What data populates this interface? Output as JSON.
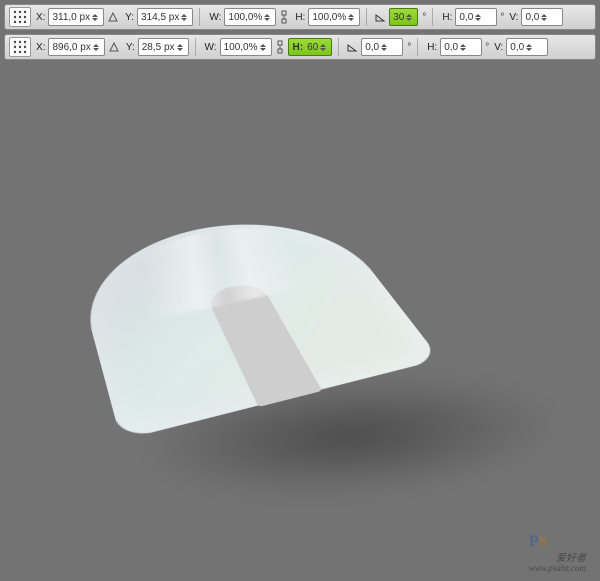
{
  "toolbar1": {
    "x_label": "X:",
    "x_value": "311,0 px",
    "y_label": "Y:",
    "y_value": "314,5 px",
    "w_label": "W:",
    "w_value": "100,0%",
    "h_label": "H:",
    "h_value": "100,0%",
    "angle_value": "30",
    "hshear_label": "H:",
    "hshear_value": "0,0",
    "vshear_label": "V:",
    "vshear_value": "0,0"
  },
  "toolbar2": {
    "x_label": "X:",
    "x_value": "896,0 px",
    "y_label": "Y:",
    "y_value": "28,5 px",
    "w_label": "W:",
    "w_value": "100,0%",
    "h_label": "H:",
    "h_value": "60",
    "angle_value": "0,0",
    "hshear_label": "H:",
    "hshear_value": "0,0",
    "vshear_label": "V:",
    "vshear_value": "0,0"
  },
  "watermark": {
    "logo_p": "P",
    "logo_s": "S",
    "cn": "爱好者",
    "url": "www.psahz.com"
  },
  "icons": {
    "reference": "reference-point-grid-icon",
    "relative": "triangle-relative-icon",
    "link": "link-constrain-icon",
    "angle": "angle-icon"
  }
}
